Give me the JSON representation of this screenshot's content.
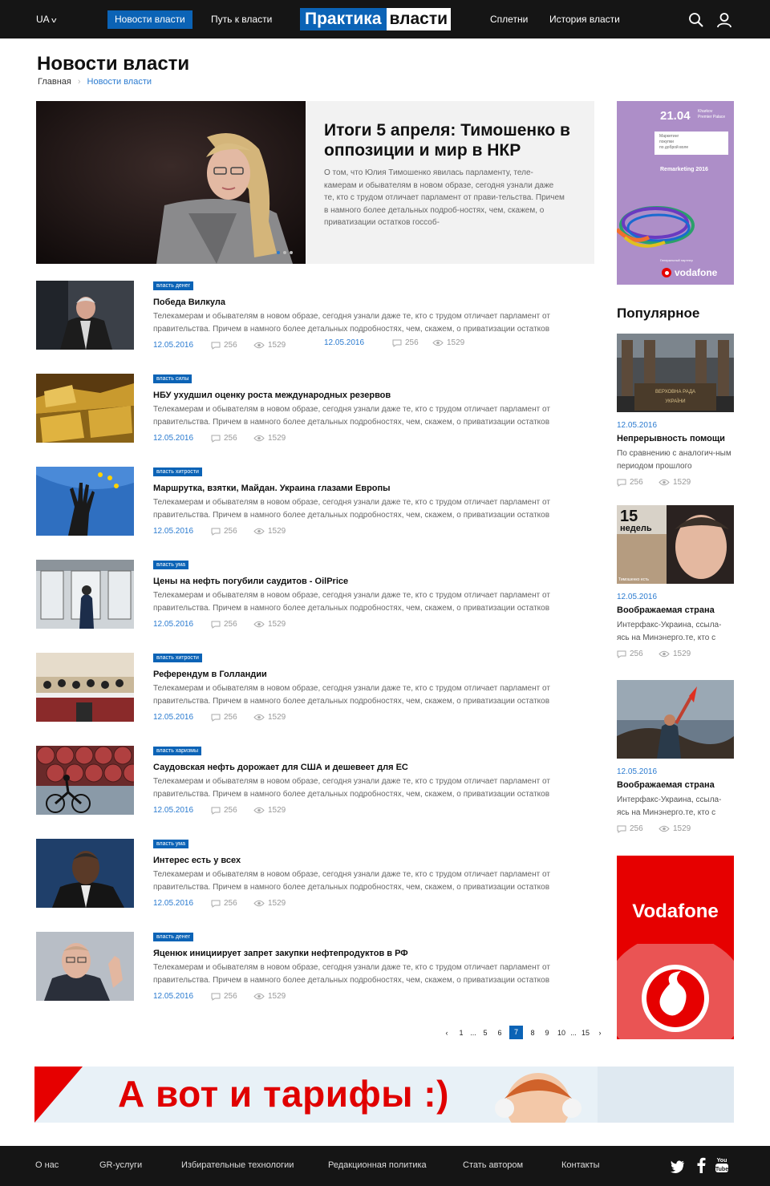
{
  "header": {
    "lang": "UA",
    "nav_left": [
      "Новости власти",
      "Путь к власти"
    ],
    "logo_part1": "Практика",
    "logo_part2": "власти",
    "nav_right": [
      "Сплетни",
      "История власти"
    ],
    "icons": [
      "search-icon",
      "user-icon"
    ]
  },
  "page": {
    "title": "Новости власти",
    "breadcrumb": [
      "Главная",
      "Новости власти"
    ]
  },
  "hero": {
    "title": "Итоги 5 апреля: Тимошенко в оппозиции и мир в НКР",
    "text": "О том, что Юлия Тимошенко явилась парламенту, теле-камерам и обывателям в новом образе, сегодня узнали даже те, кто с трудом отличает парламент от прави-тельства. Причем в намного более детальных подроб-ностях, чем, скажем, о приватизации остатков госсоб-",
    "date": "12.05.2016",
    "comments": "256",
    "views": "1529",
    "slides": 3,
    "active_slide": 1
  },
  "news": [
    {
      "tag": "власть денег",
      "title": "Победа Вилкула",
      "text": "Телекамерам и обывателям в новом образе, сегодня узнали даже те, кто с трудом отличает парламент от правительства. Причем в намного более детальных подробностях, чем, скажем, о приватизации остатков",
      "date": "12.05.2016",
      "comments": "256",
      "views": "1529"
    },
    {
      "tag": "власть силы",
      "title": "НБУ ухудшил оценку роста международных резервов",
      "text": "Телекамерам и обывателям в новом образе, сегодня узнали даже те, кто с трудом отличает парламент от правительства. Причем в намного более детальных подробностях, чем, скажем, о приватизации остатков",
      "date": "12.05.2016",
      "comments": "256",
      "views": "1529"
    },
    {
      "tag": "власть хитрости",
      "title": "Маршрутка, взятки, Майдан. Украина глазами Европы",
      "text": "Телекамерам и обывателям в новом образе, сегодня узнали даже те, кто с трудом отличает парламент от правительства. Причем в намного более детальных подробностях, чем, скажем, о приватизации остатков",
      "date": "12.05.2016",
      "comments": "256",
      "views": "1529"
    },
    {
      "tag": "власть ума",
      "title": "Цены на нефть погубили саудитов - OilPrice",
      "text": "Телекамерам и обывателям в новом образе, сегодня узнали даже те, кто с трудом отличает парламент от правительства. Причем в намного более детальных подробностях, чем, скажем, о приватизации остатков",
      "date": "12.05.2016",
      "comments": "256",
      "views": "1529"
    },
    {
      "tag": "власть хитрости",
      "title": "Референдум в Голландии",
      "text": "Телекамерам и обывателям в новом образе, сегодня узнали даже те, кто с трудом отличает парламент от правительства. Причем в намного более детальных подробностях, чем, скажем, о приватизации остатков",
      "date": "12.05.2016",
      "comments": "256",
      "views": "1529"
    },
    {
      "tag": "власть харизмы",
      "title": "Саудовская нефть дорожает для США и дешевеет для ЕС",
      "text": "Телекамерам и обывателям в новом образе, сегодня узнали даже те, кто с трудом отличает парламент от правительства. Причем в намного более детальных подробностях, чем, скажем, о приватизации остатков",
      "date": "12.05.2016",
      "comments": "256",
      "views": "1529"
    },
    {
      "tag": "власть ума",
      "title": "Интерес есть у всех",
      "text": "Телекамерам и обывателям в новом образе, сегодня узнали даже те, кто с трудом отличает парламент от правительства. Причем в намного более детальных подробностях, чем, скажем, о приватизации остатков",
      "date": "12.05.2016",
      "comments": "256",
      "views": "1529"
    },
    {
      "tag": "власть денег",
      "title": "Яценюк инициирует запрет закупки нефтепродуктов в РФ",
      "text": "Телекамерам и обывателям в новом образе, сегодня узнали даже те, кто с трудом отличает парламент от правительства. Причем в намного более детальных подробностях, чем, скажем, о приватизации остатков",
      "date": "12.05.2016",
      "comments": "256",
      "views": "1529"
    }
  ],
  "pagination": {
    "items": [
      "1",
      "...",
      "5",
      "6",
      "7",
      "8",
      "9",
      "10",
      "...",
      "15"
    ],
    "current": "7"
  },
  "sidebar_ad": {
    "date": "21.04",
    "place_line1": "Kharkov",
    "place_line2": "Premier Palace",
    "box_line1": "Маркетинг",
    "box_line2": "покупки",
    "box_line3": "по доброй воле",
    "event": "Remarketing 2016",
    "partner": "Генеральный партнер",
    "brand": "vodafone"
  },
  "popular": {
    "title": "Популярное",
    "items": [
      {
        "date": "12.05.2016",
        "title": "Непрерывность помощи",
        "text": "По сравнению с аналогич-ным периодом прошлого",
        "comments": "256",
        "views": "1529",
        "img_text": "ВЕРХОВНА РАДА УКРАЇНИ"
      },
      {
        "date": "12.05.2016",
        "title": "Воображаемая страна",
        "text": "Интерфакс-Украина, ссыла-ясь на Минэнерго.те, кто с",
        "comments": "256",
        "views": "1529",
        "img_text": "15 ½ недель",
        "img_caption": "Тимошенко есть"
      },
      {
        "date": "12.05.2016",
        "title": "Воображаемая страна",
        "text": "Интерфакс-Украина, ссыла-ясь на Минэнерго.те, кто с",
        "comments": "256",
        "views": "1529"
      }
    ]
  },
  "vodafone_ad": {
    "brand": "Vodafone"
  },
  "banner": {
    "text": "А вот и тарифы :)"
  },
  "footer": {
    "links": [
      "О нас",
      "GR-услуги",
      "Избирательные технологии",
      "Редакционная политика",
      "Стать автором",
      "Контакты"
    ],
    "social": [
      "twitter-icon",
      "facebook-icon",
      "youtube-icon"
    ],
    "youtube_label": "You Tube"
  },
  "colors": {
    "accent": "#0b63b6",
    "link": "#2b7bd0",
    "dark": "#151515",
    "vodafone": "#e60000"
  }
}
